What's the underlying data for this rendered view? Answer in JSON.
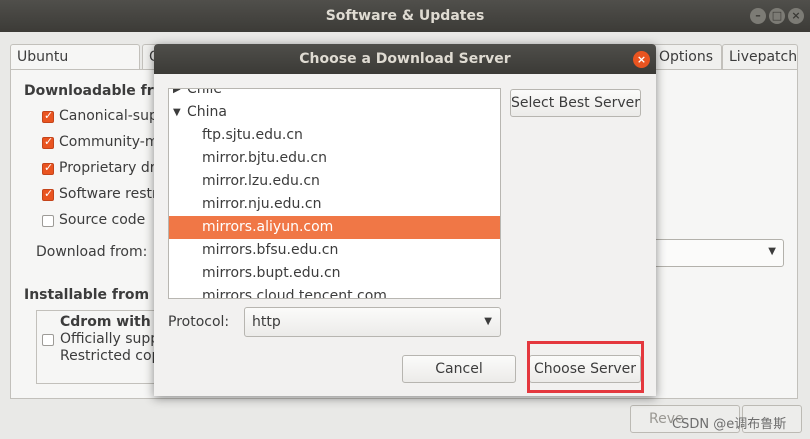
{
  "window": {
    "title": "Software & Updates"
  },
  "tabs": [
    "Ubuntu Software",
    "O",
    "Options",
    "Livepatch"
  ],
  "main": {
    "downloadable_heading": "Downloadable from",
    "checkboxes": [
      {
        "label": "Canonical-supp",
        "checked": true
      },
      {
        "label": "Community-m",
        "checked": true
      },
      {
        "label": "Proprietary dr",
        "checked": true
      },
      {
        "label": "Software restr",
        "checked": true
      },
      {
        "label": "Source code",
        "checked": false
      }
    ],
    "download_from_label": "Download from:",
    "installable_heading": "Installable from C",
    "cdrom": {
      "title": "Cdrom with U",
      "line1": "Officially supp",
      "line2": "Restricted cop"
    },
    "revert_label": "Reve"
  },
  "dialog": {
    "title": "Choose a Download Server",
    "countries": [
      {
        "name": "Chile",
        "expanded": false
      },
      {
        "name": "China",
        "expanded": true
      }
    ],
    "mirrors": [
      "ftp.sjtu.edu.cn",
      "mirror.bjtu.edu.cn",
      "mirror.lzu.edu.cn",
      "mirror.nju.edu.cn",
      "mirrors.aliyun.com",
      "mirrors.bfsu.edu.cn",
      "mirrors.bupt.edu.cn",
      "mirrors.cloud.tencent.com"
    ],
    "selected_mirror": "mirrors.aliyun.com",
    "select_best_label": "Select Best Server",
    "protocol_label": "Protocol:",
    "protocol_value": "http",
    "cancel_label": "Cancel",
    "choose_label": "Choose Server"
  },
  "watermark": "CSDN @e调布鲁斯",
  "colors": {
    "accent": "#e95420",
    "selection": "#f07746",
    "highlight_box": "#e4383e"
  }
}
